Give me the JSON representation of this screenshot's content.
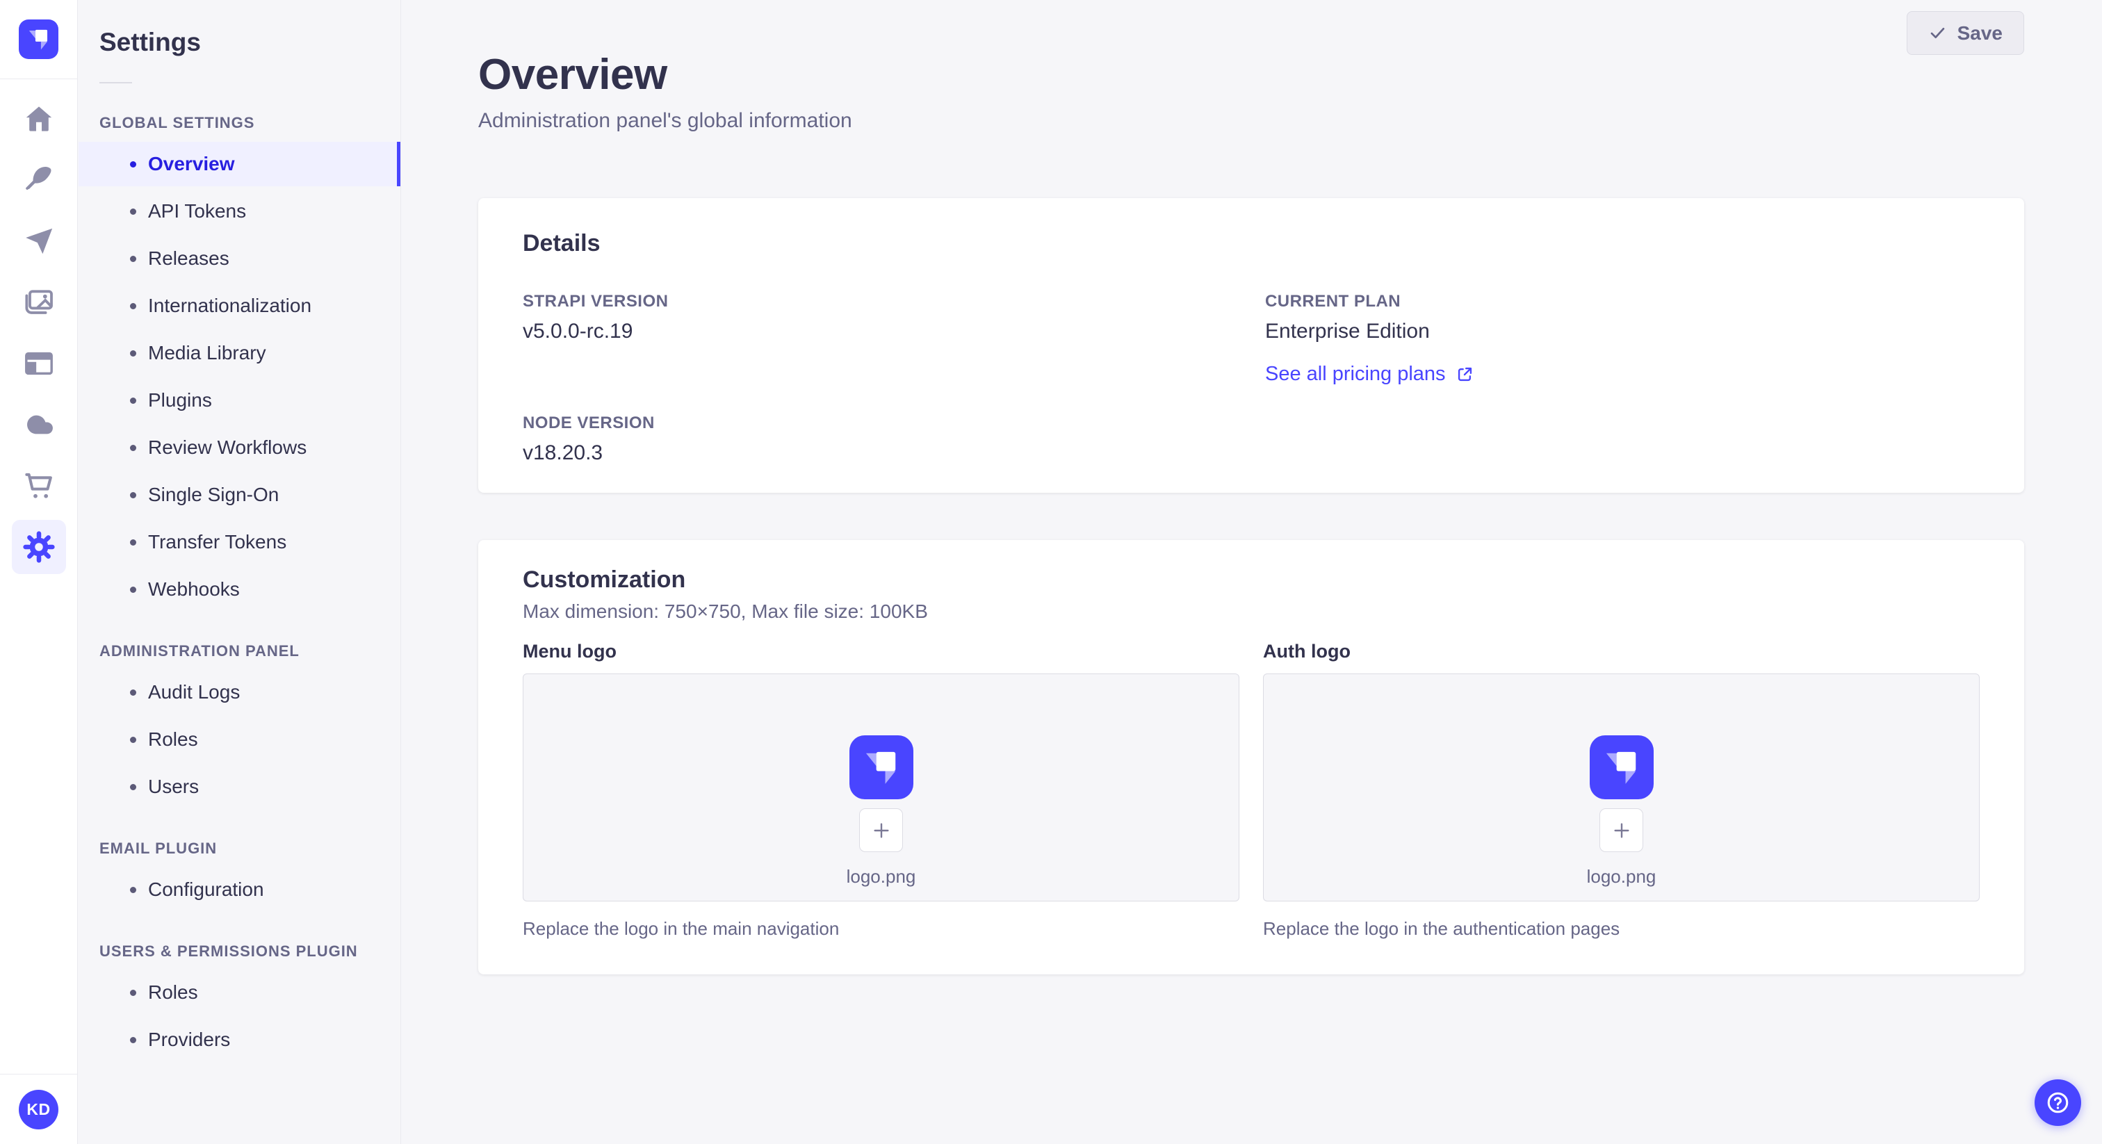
{
  "colors": {
    "primary": "#4945ff",
    "primary_text_active": "#271fe0",
    "active_bg": "#f0f0ff",
    "page_bg": "#f6f6f9",
    "text": "#32324d",
    "muted_text": "#666687",
    "border": "#eaeaef"
  },
  "icon_rail": {
    "logo_icon": "strapi-logo",
    "items": [
      {
        "icon": "home-icon",
        "active": false
      },
      {
        "icon": "feather-icon",
        "active": false
      },
      {
        "icon": "paper-plane-icon",
        "active": false
      },
      {
        "icon": "pictures-icon",
        "active": false
      },
      {
        "icon": "layout-icon",
        "active": false
      },
      {
        "icon": "cloud-icon",
        "active": false
      },
      {
        "icon": "cart-icon",
        "active": false
      },
      {
        "icon": "gear-icon",
        "active": true
      }
    ],
    "user_initials": "KD"
  },
  "sidebar": {
    "title": "Settings",
    "sections": [
      {
        "heading": "GLOBAL SETTINGS",
        "items": [
          {
            "label": "Overview",
            "active": true
          },
          {
            "label": "API Tokens",
            "active": false
          },
          {
            "label": "Releases",
            "active": false
          },
          {
            "label": "Internationalization",
            "active": false
          },
          {
            "label": "Media Library",
            "active": false
          },
          {
            "label": "Plugins",
            "active": false
          },
          {
            "label": "Review Workflows",
            "active": false
          },
          {
            "label": "Single Sign-On",
            "active": false
          },
          {
            "label": "Transfer Tokens",
            "active": false
          },
          {
            "label": "Webhooks",
            "active": false
          }
        ]
      },
      {
        "heading": "ADMINISTRATION PANEL",
        "items": [
          {
            "label": "Audit Logs",
            "active": false
          },
          {
            "label": "Roles",
            "active": false
          },
          {
            "label": "Users",
            "active": false
          }
        ]
      },
      {
        "heading": "EMAIL PLUGIN",
        "items": [
          {
            "label": "Configuration",
            "active": false
          }
        ]
      },
      {
        "heading": "USERS & PERMISSIONS PLUGIN",
        "items": [
          {
            "label": "Roles",
            "active": false
          },
          {
            "label": "Providers",
            "active": false
          }
        ]
      }
    ]
  },
  "header": {
    "title": "Overview",
    "subtitle": "Administration panel's global information",
    "save_label": "Save",
    "save_icon": "check-icon"
  },
  "details": {
    "title": "Details",
    "strapi_version": {
      "label": "STRAPI VERSION",
      "value": "v5.0.0-rc.19"
    },
    "current_plan": {
      "label": "CURRENT PLAN",
      "value": "Enterprise Edition"
    },
    "node_version": {
      "label": "NODE VERSION",
      "value": "v18.20.3"
    },
    "pricing_link_label": "See all pricing plans",
    "pricing_link_icon": "external-link-icon"
  },
  "customization": {
    "title": "Customization",
    "subtitle": "Max dimension: 750×750, Max file size: 100KB",
    "menu_logo": {
      "label": "Menu logo",
      "filename": "logo.png",
      "helper": "Replace the logo in the main navigation",
      "add_icon": "plus-icon"
    },
    "auth_logo": {
      "label": "Auth logo",
      "filename": "logo.png",
      "helper": "Replace the logo in the authentication pages",
      "add_icon": "plus-icon"
    }
  },
  "help_button": {
    "icon": "question-mark-circle-icon"
  }
}
